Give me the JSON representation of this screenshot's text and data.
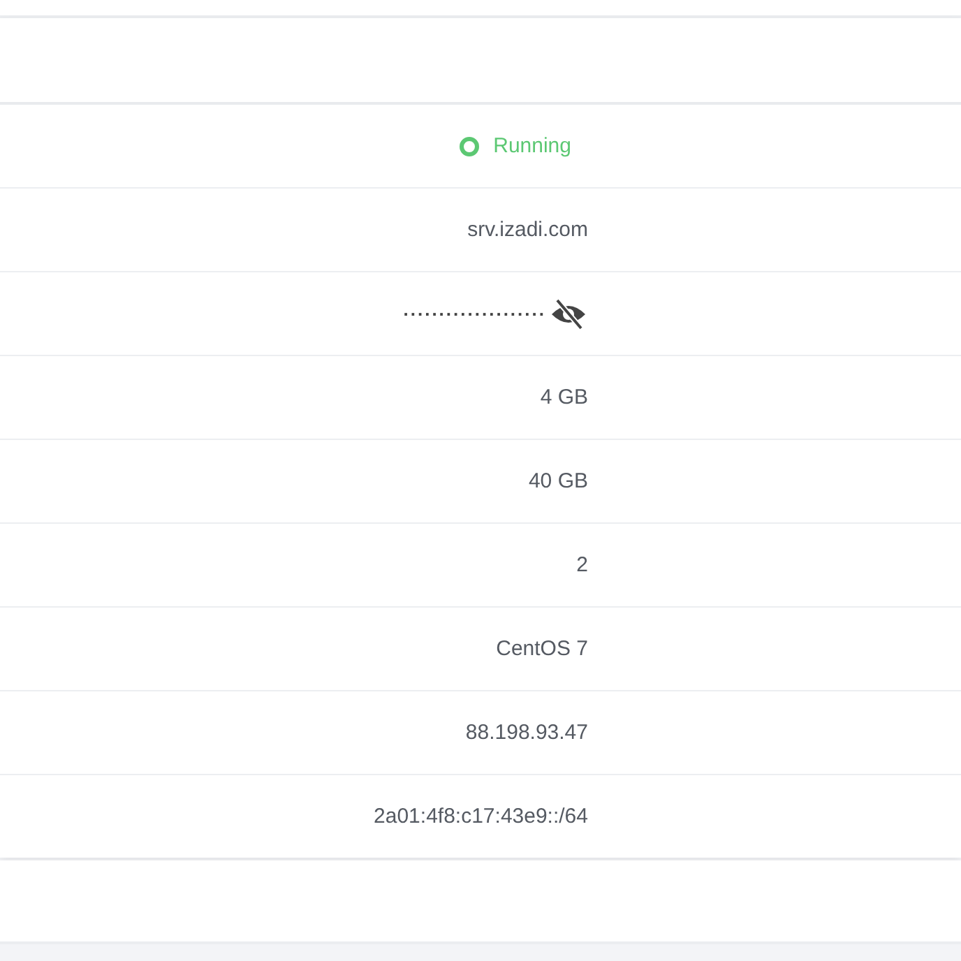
{
  "details": {
    "rows": [
      {
        "kind": "status",
        "value": "Running",
        "color": "#5cc873"
      },
      {
        "kind": "text",
        "value": "srv.izadi.com"
      },
      {
        "kind": "password",
        "value": "....................",
        "masked": true
      },
      {
        "kind": "text",
        "value": "4 GB"
      },
      {
        "kind": "text",
        "value": "40 GB"
      },
      {
        "kind": "text",
        "value": "2"
      },
      {
        "kind": "text",
        "value": "CentOS 7"
      },
      {
        "kind": "text",
        "value": "88.198.93.47"
      },
      {
        "kind": "text",
        "value": "2a01:4f8:c17:43e9::/64"
      }
    ]
  }
}
